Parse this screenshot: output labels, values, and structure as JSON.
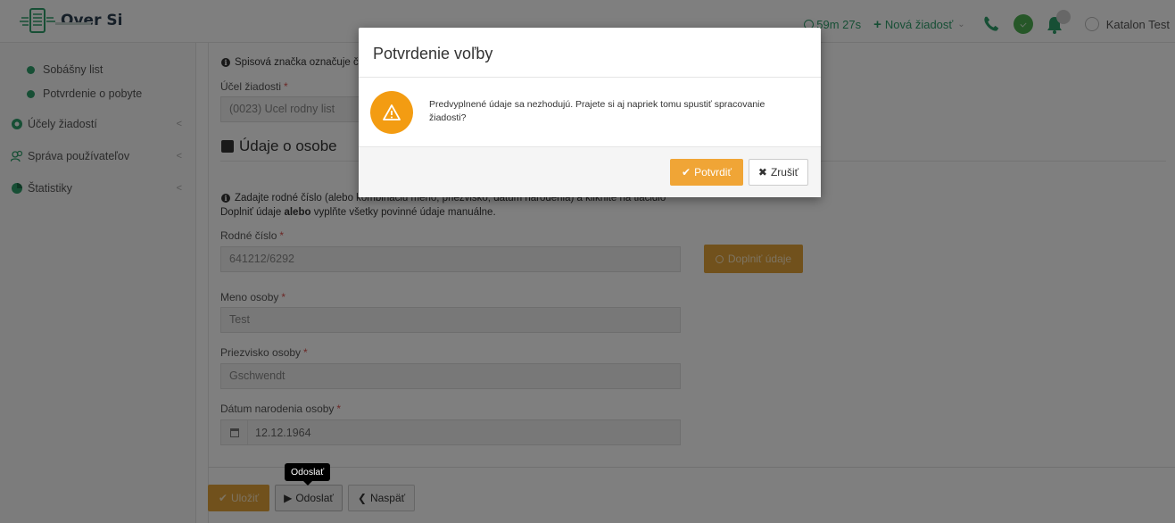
{
  "app": {
    "title": "Over Si"
  },
  "topbar": {
    "timer": "59m 27s",
    "new_request": "Nová žiadosť",
    "user_name": "Katalon Test"
  },
  "sidebar": {
    "sub_items": [
      {
        "label": "Sobášny list"
      },
      {
        "label": "Potvrdenie o pobyte"
      }
    ],
    "items": [
      {
        "label": "Účely žiadostí"
      },
      {
        "label": "Správa používateľov"
      },
      {
        "label": "Štatistiky"
      }
    ]
  },
  "form": {
    "file_note": "Spisová značka označuje čí",
    "purpose_label": "Účel žiadosti",
    "purpose_value": "(0023) Ucel rodny list",
    "section_title": "Údaje o osobe",
    "info_line1": "Zadajte rodné číslo (alebo kombináciu meno, priezvisko, dátum narodenia) a kliknite na tlačidlo",
    "info_line2_a": "Doplniť údaje",
    "info_line2_b": "alebo",
    "info_line2_c": "vyplňte všetky povinné údaje manuálne.",
    "birth_number_label": "Rodné číslo",
    "birth_number_value": "641212/6292",
    "fill_button": "Doplniť údaje",
    "first_name_label": "Meno osoby",
    "first_name_value": "Test",
    "last_name_label": "Priezvisko osoby",
    "last_name_value": "Gschwendt",
    "dob_label": "Dátum narodenia osoby",
    "dob_value": "12.12.1964",
    "required_mark": "*"
  },
  "actions": {
    "save": "Uložiť",
    "send": "Odoslať",
    "back": "Naspäť",
    "tooltip": "Odoslať"
  },
  "modal": {
    "title": "Potvrdenie voľby",
    "message": "Predvyplnené údaje sa nezhodujú. Prajete si aj napriek tomu spustiť spracovanie žiadosti?",
    "confirm": "Potvrdiť",
    "cancel": "Zrušiť"
  },
  "colors": {
    "brand_green": "#2e9e6b",
    "warning_orange": "#f39c12",
    "button_orange": "#e3a338",
    "required_red": "#d9534f"
  },
  "icons": [
    "logo-icon",
    "clock-icon",
    "plus-icon",
    "phone-icon",
    "status-icon",
    "bell-icon",
    "user-icon",
    "info-icon",
    "edit-icon",
    "search-icon",
    "calendar-icon",
    "check-icon",
    "play-icon",
    "back-icon",
    "warning-icon",
    "close-icon"
  ]
}
